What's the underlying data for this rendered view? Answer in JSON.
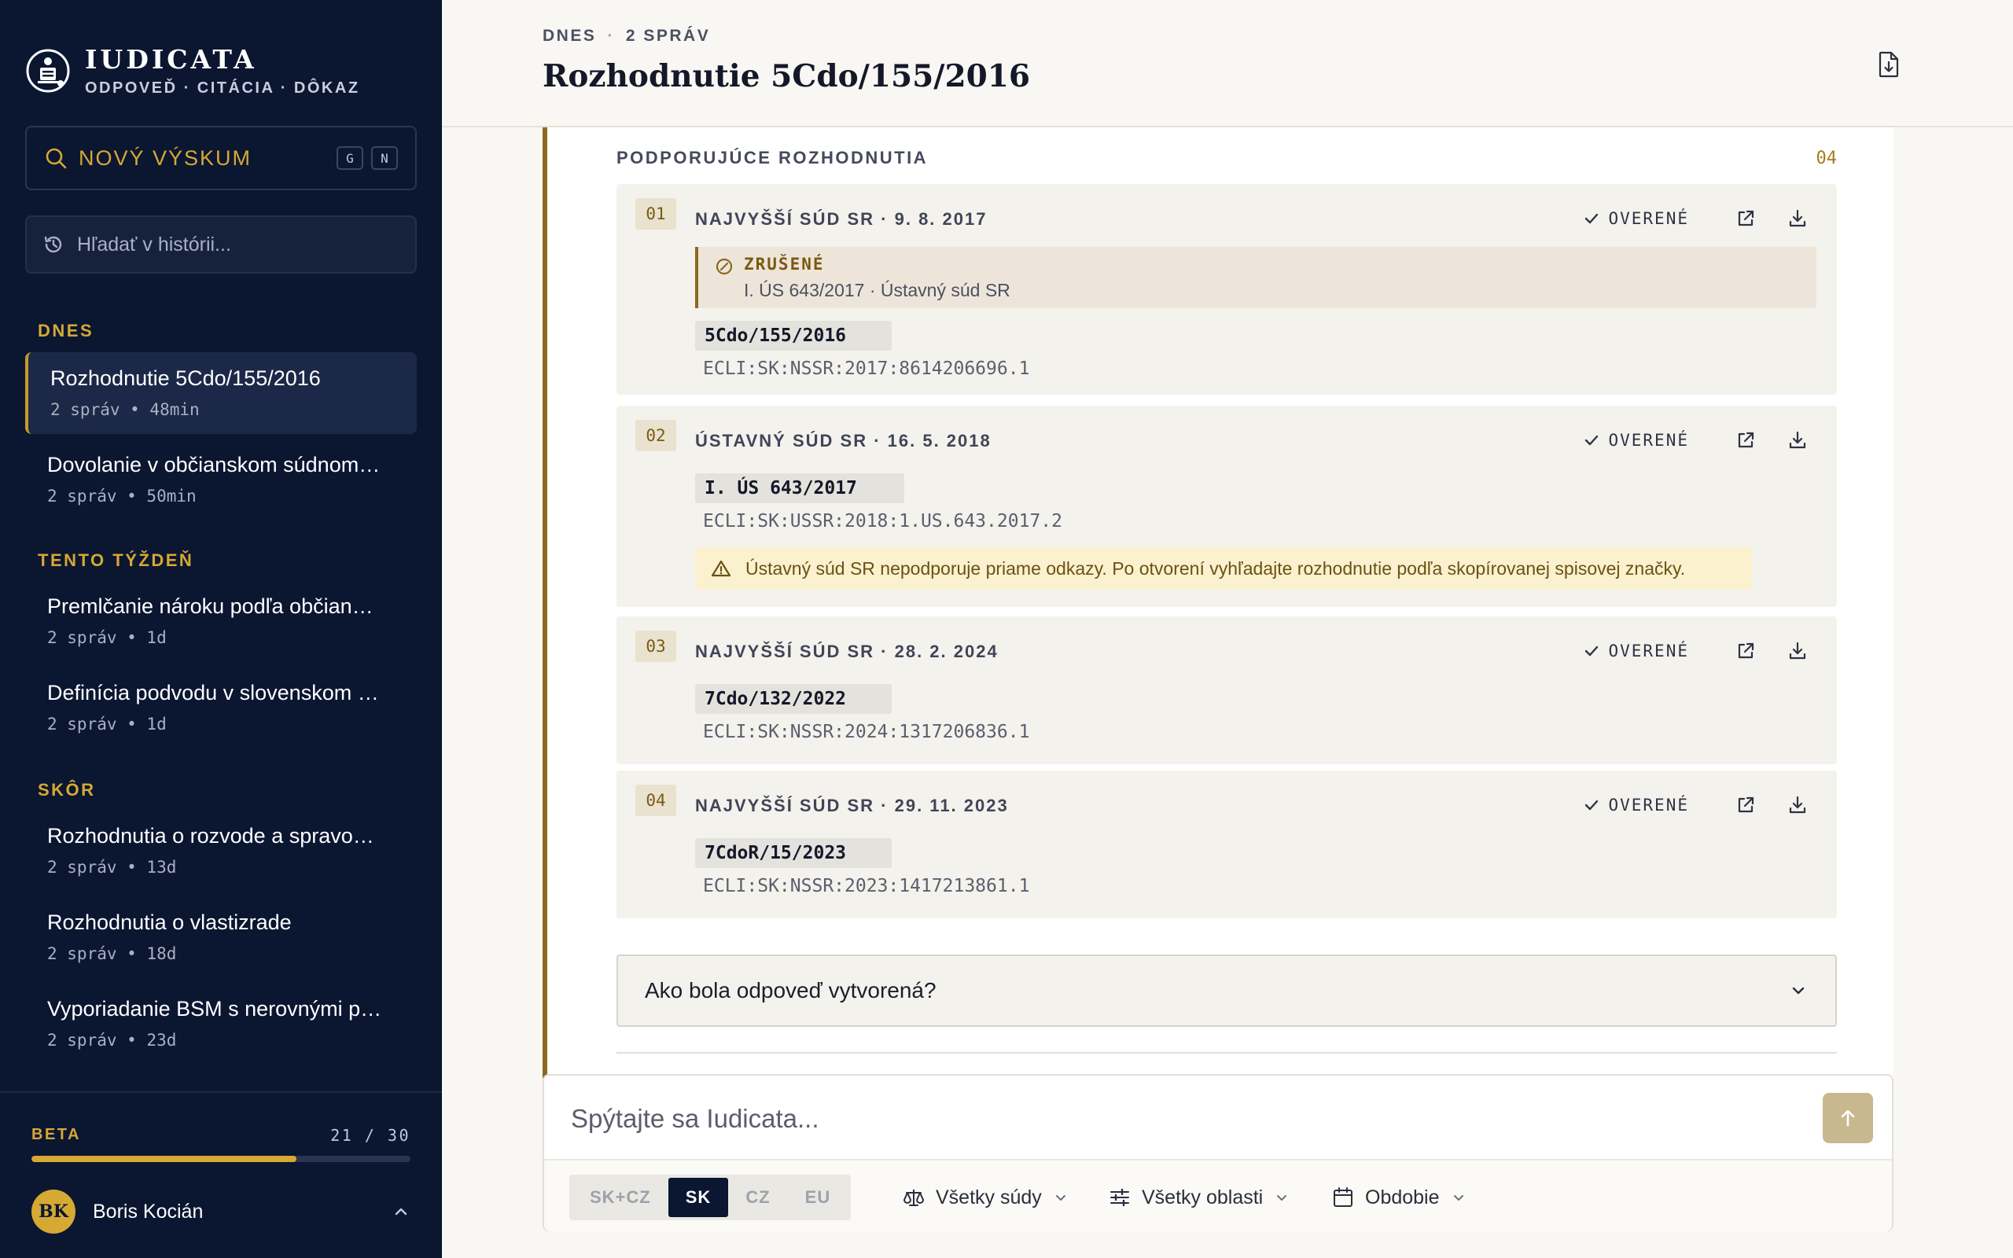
{
  "brand": {
    "name": "IUDICATA",
    "tagline": "ODPOVEĎ · CITÁCIA · DÔKAZ"
  },
  "new_research": {
    "label": "NOVÝ VÝSKUM",
    "keys": [
      "G",
      "N"
    ]
  },
  "history_search": {
    "placeholder": "Hľadať v histórii..."
  },
  "history": {
    "today": {
      "label": "DNES",
      "items": [
        {
          "title": "Rozhodnutie 5Cdo/155/2016",
          "meta": "2 správ • 48min"
        },
        {
          "title": "Dovolanie v občianskom súdnom…",
          "meta": "2 správ • 50min"
        }
      ]
    },
    "week": {
      "label": "TENTO TÝŽDEŇ",
      "items": [
        {
          "title": "Premlčanie nároku podľa občian…",
          "meta": "2 správ • 1d"
        },
        {
          "title": "Definícia podvodu v slovenskom …",
          "meta": "2 správ • 1d"
        }
      ]
    },
    "earlier": {
      "label": "SKÔR",
      "items": [
        {
          "title": "Rozhodnutia o rozvode a spravo…",
          "meta": "2 správ • 13d"
        },
        {
          "title": "Rozhodnutia o vlastizrade",
          "meta": "2 správ • 18d"
        },
        {
          "title": "Vyporiadanie BSM s nerovnými p…",
          "meta": "2 správ • 23d"
        }
      ]
    }
  },
  "beta": {
    "label": "BETA",
    "count": "21 / 30",
    "fraction": 0.7
  },
  "user": {
    "initials": "BK",
    "name": "Boris Kocián"
  },
  "header": {
    "crumb_day": "DNES",
    "crumb_count": "2 SPRÁV",
    "title": "Rozhodnutie 5Cdo/155/2016"
  },
  "sources": {
    "title": "PODPORUJÚCE ROZHODNUTIA",
    "count": "04",
    "verified_label": "OVERENÉ",
    "items": [
      {
        "num": "01",
        "court": "NAJVYŠŠÍ SÚD SR · 9. 8. 2017",
        "annul_label": "ZRUŠENÉ",
        "annul_text": "I. ÚS 643/2017 · Ústavný súd SR",
        "case": "5Cdo/155/2016",
        "ecli": "ECLI:SK:NSSR:2017:8614206696.1"
      },
      {
        "num": "02",
        "court": "ÚSTAVNÝ SÚD SR · 16. 5. 2018",
        "case": "I. ÚS 643/2017",
        "ecli": "ECLI:SK:USSR:2018:1.US.643.2017.2",
        "warning": "Ústavný súd SR nepodporuje priame odkazy. Po otvorení vyhľadajte rozhodnutie podľa skopírovanej spisovej značky."
      },
      {
        "num": "03",
        "court": "NAJVYŠŠÍ SÚD SR · 28. 2. 2024",
        "case": "7Cdo/132/2022",
        "ecli": "ECLI:SK:NSSR:2024:1317206836.1"
      },
      {
        "num": "04",
        "court": "NAJVYŠŠÍ SÚD SR · 29. 11. 2023",
        "case": "7CdoR/15/2023",
        "ecli": "ECLI:SK:NSSR:2023:1417213861.1"
      }
    ]
  },
  "how": {
    "label": "Ako bola odpoveď vytvorená?"
  },
  "composer": {
    "placeholder": "Spýtajte sa Iudicata...",
    "jurisdictions": [
      "SK+CZ",
      "SK",
      "CZ",
      "EU"
    ],
    "selected_jurisdiction": "SK",
    "filters": {
      "courts": "Všetky súdy",
      "areas": "Všetky oblasti",
      "period": "Obdobie"
    }
  },
  "colors": {
    "sidebar_bg": "#0b1631",
    "accent_gold": "#d6a933",
    "accent_dark_gold": "#8a6a1c",
    "send_button": "#c8b88f"
  }
}
